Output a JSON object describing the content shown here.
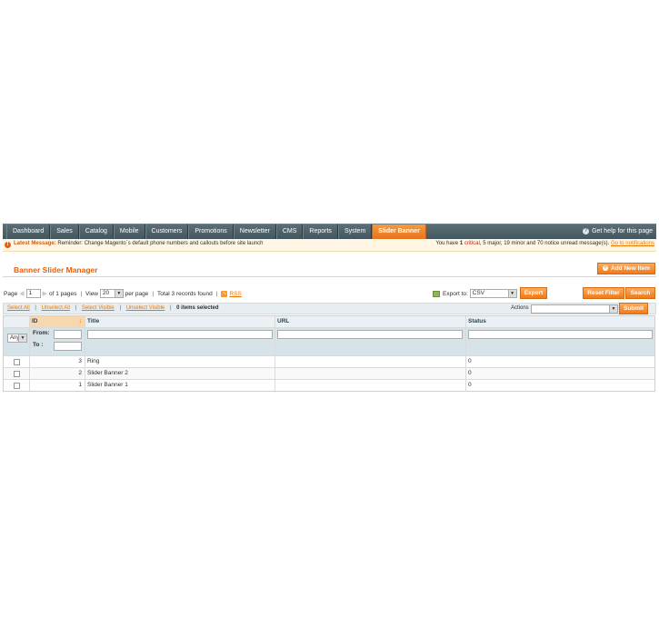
{
  "nav": {
    "tabs": [
      "Dashboard",
      "Sales",
      "Catalog",
      "Mobile",
      "Customers",
      "Promotions",
      "Newsletter",
      "CMS",
      "Reports",
      "System",
      "Slider Banner"
    ],
    "active_tab": "Slider Banner",
    "help": "Get help for this page"
  },
  "message": {
    "label": "Latest Message:",
    "text": "Reminder: Change Magento`s default phone numbers and callouts before site launch",
    "summary_prefix": "You have",
    "critical_count": "1",
    "critical_label": "critical",
    "major": "5 major,",
    "minor": "19 minor and",
    "notice": "70 notice unread message(s).",
    "link": "Go to notifications"
  },
  "page": {
    "title": "Banner Slider Manager",
    "add_button": "Add New Item"
  },
  "pager": {
    "page_label": "Page",
    "page_value": "1",
    "of_pages": "of 1 pages",
    "view_label": "View",
    "per_page_value": "20",
    "per_page_label": "per page",
    "total": "Total 3 records found",
    "rss": "RSS"
  },
  "export": {
    "label": "Export to:",
    "format": "CSV",
    "button": "Export"
  },
  "filter_buttons": {
    "reset": "Reset Filter",
    "search": "Search"
  },
  "massaction": {
    "select_all": "Select All",
    "unselect_all": "Unselect All",
    "select_visible": "Select Visible",
    "unselect_visible": "Unselect Visible",
    "selected": "0 items selected",
    "actions_label": "Actions",
    "submit": "Submit"
  },
  "grid": {
    "columns": [
      "ID",
      "Title",
      "URL",
      "Status"
    ],
    "filter_any": "Any",
    "from_label": "From:",
    "to_label": "To :",
    "rows": [
      {
        "id": "3",
        "title": "Ring",
        "url": "",
        "status": "0"
      },
      {
        "id": "2",
        "title": "Slider Banner 2",
        "url": "",
        "status": "0"
      },
      {
        "id": "1",
        "title": "Slider Banner 1",
        "url": "",
        "status": "0"
      }
    ]
  }
}
